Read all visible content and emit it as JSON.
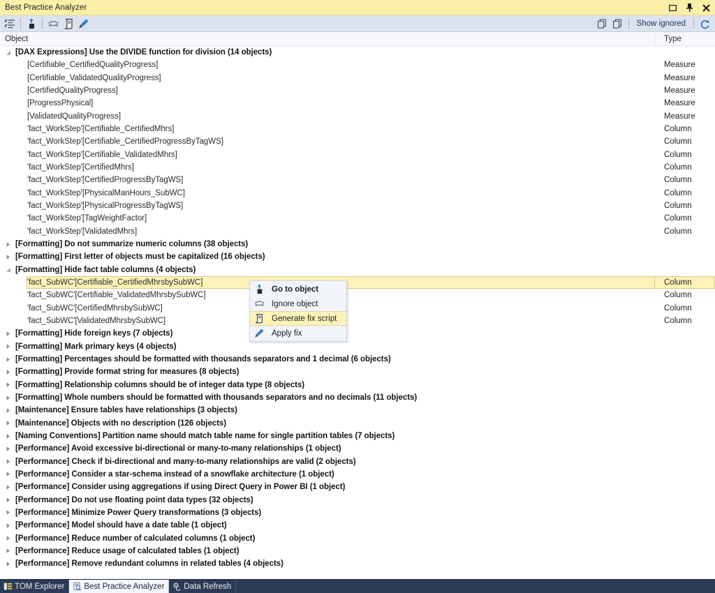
{
  "window": {
    "title": "Best Practice Analyzer",
    "titlebar_color": "#fcf0a8",
    "buttons": [
      {
        "name": "maximize-button",
        "icon": "maximize-icon"
      },
      {
        "name": "pin-button",
        "icon": "pin-icon"
      },
      {
        "name": "close-button",
        "icon": "close-icon"
      }
    ]
  },
  "toolbar": {
    "left_buttons": [
      {
        "name": "show-all-button",
        "icon": "list-settings-icon",
        "tooltip": ""
      },
      {
        "name": "go-to-object-button",
        "icon": "go-to-object-icon",
        "tooltip": ""
      },
      {
        "name": "ignore-object-button",
        "icon": "ignore-object-icon",
        "tooltip": ""
      },
      {
        "name": "generate-fix-script-button",
        "icon": "script-icon",
        "tooltip": ""
      },
      {
        "name": "apply-fix-button",
        "icon": "brush-icon",
        "tooltip": ""
      }
    ],
    "copy_buttons": [
      {
        "name": "copy-button",
        "icon": "copy-icon"
      },
      {
        "name": "copy-all-button",
        "icon": "copy-all-icon"
      }
    ],
    "show_ignored_label": "Show ignored",
    "refresh_icon": "refresh-icon"
  },
  "columns": {
    "object": "Object",
    "type": "Type"
  },
  "context_menu": {
    "items": [
      {
        "label": "Go to object",
        "icon": "go-to-object-icon",
        "bold": true,
        "hover": false
      },
      {
        "label": "Ignore object",
        "icon": "ignore-object-icon",
        "bold": false,
        "hover": false
      },
      {
        "label": "Generate fix script",
        "icon": "script-icon",
        "bold": false,
        "hover": true
      },
      {
        "label": "Apply fix",
        "icon": "brush-icon",
        "bold": false,
        "hover": false
      }
    ]
  },
  "tabs": [
    {
      "label": "TOM Explorer",
      "icon": "tom-explorer-icon",
      "active": false
    },
    {
      "label": "Best Practice Analyzer",
      "icon": "bpa-icon",
      "active": true
    },
    {
      "label": "Data Refresh",
      "icon": "data-refresh-icon",
      "active": false
    }
  ],
  "rows": [
    {
      "kind": "group",
      "expanded": true,
      "label": "[DAX Expressions] Use the DIVIDE function for division (14 objects)",
      "type": ""
    },
    {
      "kind": "child",
      "label": "[Certifiable_CertifiedQualityProgress]",
      "type": "Measure"
    },
    {
      "kind": "child",
      "label": "[Certifiable_ValidatedQualityProgress]",
      "type": "Measure"
    },
    {
      "kind": "child",
      "label": "[CertifiedQualityProgress]",
      "type": "Measure"
    },
    {
      "kind": "child",
      "label": "[ProgressPhysical]",
      "type": "Measure"
    },
    {
      "kind": "child",
      "label": "[ValidatedQualityProgress]",
      "type": "Measure"
    },
    {
      "kind": "child",
      "label": "'fact_WorkStep'[Certifiable_CertifiedMhrs]",
      "type": "Column"
    },
    {
      "kind": "child",
      "label": "'fact_WorkStep'[Certifiable_CertifiedProgressByTagWS]",
      "type": "Column"
    },
    {
      "kind": "child",
      "label": "'fact_WorkStep'[Certifiable_ValidatedMhrs]",
      "type": "Column"
    },
    {
      "kind": "child",
      "label": "'fact_WorkStep'[CertifiedMhrs]",
      "type": "Column"
    },
    {
      "kind": "child",
      "label": "'fact_WorkStep'[CertifiedProgressByTagWS]",
      "type": "Column"
    },
    {
      "kind": "child",
      "label": "'fact_WorkStep'[PhysicalManHours_SubWC]",
      "type": "Column"
    },
    {
      "kind": "child",
      "label": "'fact_WorkStep'[PhysicalProgressByTagWS]",
      "type": "Column"
    },
    {
      "kind": "child",
      "label": "'fact_WorkStep'[TagWeightFactor]",
      "type": "Column"
    },
    {
      "kind": "child",
      "label": "'fact_WorkStep'[ValidatedMhrs]",
      "type": "Column"
    },
    {
      "kind": "group",
      "expanded": false,
      "label": "[Formatting] Do not summarize numeric columns (38 objects)",
      "type": ""
    },
    {
      "kind": "group",
      "expanded": false,
      "label": "[Formatting] First letter of objects must be capitalized (16 objects)",
      "type": ""
    },
    {
      "kind": "group",
      "expanded": true,
      "label": "[Formatting] Hide fact table columns (4 objects)",
      "type": ""
    },
    {
      "kind": "child",
      "selected": true,
      "label": "'fact_SubWC'[Certifiable_CertifiedMhrsbySubWC]",
      "type": "Column"
    },
    {
      "kind": "child",
      "label": "'fact_SubWC'[Certifiable_ValidatedMhrsbySubWC]",
      "type": "Column"
    },
    {
      "kind": "child",
      "label": "'fact_SubWC'[CertifiedMhrsbySubWC]",
      "type": "Column"
    },
    {
      "kind": "child",
      "label": "'fact_SubWC'[ValidatedMhrsbySubWC]",
      "type": "Column"
    },
    {
      "kind": "group",
      "expanded": false,
      "label": "[Formatting] Hide foreign keys (7 objects)",
      "type": ""
    },
    {
      "kind": "group",
      "expanded": false,
      "label": "[Formatting] Mark primary keys (4 objects)",
      "type": ""
    },
    {
      "kind": "group",
      "expanded": false,
      "label": "[Formatting] Percentages should be formatted with thousands separators and 1 decimal (6 objects)",
      "type": ""
    },
    {
      "kind": "group",
      "expanded": false,
      "label": "[Formatting] Provide format string for measures (8 objects)",
      "type": ""
    },
    {
      "kind": "group",
      "expanded": false,
      "label": "[Formatting] Relationship columns should be of integer data type (8 objects)",
      "type": ""
    },
    {
      "kind": "group",
      "expanded": false,
      "label": "[Formatting] Whole numbers should be formatted with thousands separators and no decimals (11 objects)",
      "type": ""
    },
    {
      "kind": "group",
      "expanded": false,
      "label": "[Maintenance] Ensure tables have relationships (3 objects)",
      "type": ""
    },
    {
      "kind": "group",
      "expanded": false,
      "label": "[Maintenance] Objects with no description (126 objects)",
      "type": ""
    },
    {
      "kind": "group",
      "expanded": false,
      "label": "[Naming Conventions] Partition name should match table name for single partition tables (7 objects)",
      "type": ""
    },
    {
      "kind": "group",
      "expanded": false,
      "label": "[Performance] Avoid excessive bi-directional or many-to-many relationships (1 object)",
      "type": ""
    },
    {
      "kind": "group",
      "expanded": false,
      "label": "[Performance] Check if bi-directional and many-to-many relationships are valid (2 objects)",
      "type": ""
    },
    {
      "kind": "group",
      "expanded": false,
      "label": "[Performance] Consider a star-schema instead of a snowflake architecture (1 object)",
      "type": ""
    },
    {
      "kind": "group",
      "expanded": false,
      "label": "[Performance] Consider using aggregations if using Direct Query in Power BI (1 object)",
      "type": ""
    },
    {
      "kind": "group",
      "expanded": false,
      "label": "[Performance] Do not use floating point data types (32 objects)",
      "type": ""
    },
    {
      "kind": "group",
      "expanded": false,
      "label": "[Performance] Minimize Power Query transformations (3 objects)",
      "type": ""
    },
    {
      "kind": "group",
      "expanded": false,
      "label": "[Performance] Model should have a date table (1 object)",
      "type": ""
    },
    {
      "kind": "group",
      "expanded": false,
      "label": "[Performance] Reduce number of calculated columns (1 object)",
      "type": ""
    },
    {
      "kind": "group",
      "expanded": false,
      "label": "[Performance] Reduce usage of calculated tables (1 object)",
      "type": ""
    },
    {
      "kind": "group",
      "expanded": false,
      "label": "[Performance] Remove redundant columns in related tables (4 objects)",
      "type": ""
    }
  ]
}
